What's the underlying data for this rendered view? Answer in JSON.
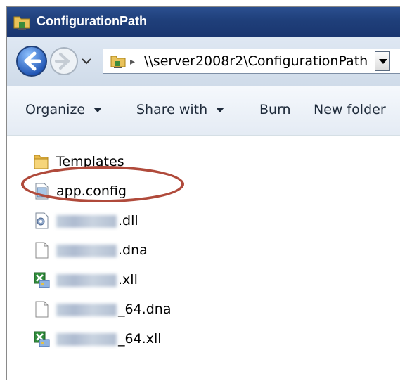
{
  "window": {
    "title": "ConfigurationPath"
  },
  "navigation": {
    "address": "\\\\server2008r2\\ConfigurationPath"
  },
  "toolbar": {
    "organize": "Organize",
    "share_with": "Share with",
    "burn": "Burn",
    "new_folder": "New folder"
  },
  "files": [
    {
      "name": "Templates",
      "icon": "folder-icon"
    },
    {
      "name": "app.config",
      "icon": "config-file-icon",
      "highlighted": true
    },
    {
      "name": ".dll",
      "icon": "dll-file-icon",
      "redacted_prefix": true
    },
    {
      "name": ".dna",
      "icon": "blank-file-icon",
      "redacted_prefix": true
    },
    {
      "name": ".xll",
      "icon": "excel-addin-icon",
      "redacted_prefix": true
    },
    {
      "name": "_64.dna",
      "icon": "blank-file-icon",
      "redacted_prefix": true
    },
    {
      "name": "_64.xll",
      "icon": "excel-addin-icon",
      "redacted_prefix": true
    }
  ],
  "colors": {
    "title_bar": "#1f3f7a",
    "highlight_ring": "#b04a3b"
  }
}
